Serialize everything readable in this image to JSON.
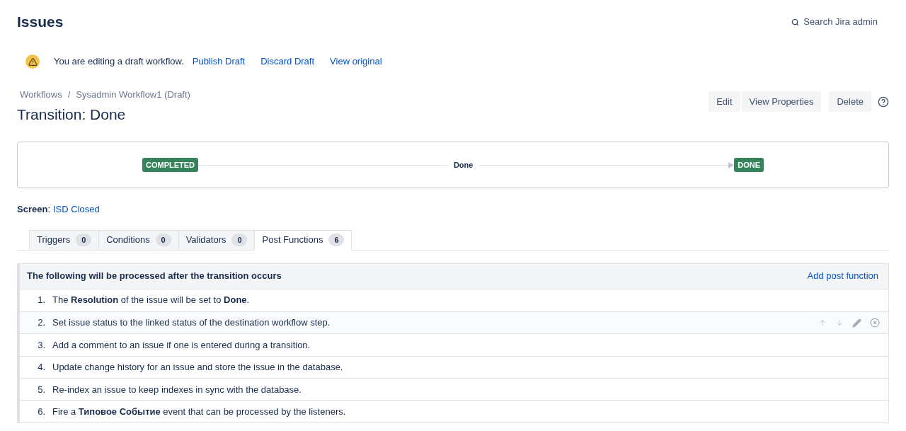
{
  "header": {
    "title": "Issues",
    "search": "Search Jira admin"
  },
  "draft_notice": {
    "message": "You are editing a draft workflow.",
    "links": [
      "Publish Draft",
      "Discard Draft",
      "View original"
    ]
  },
  "breadcrumbs": [
    "Workflows",
    "Sysadmin Workflow1 (Draft)"
  ],
  "breadcrumb_separator": "/",
  "page_title": "Transition: Done",
  "actions": [
    "Edit",
    "View Properties",
    "Delete"
  ],
  "diagram": {
    "from": "COMPLETED",
    "transition": "Done",
    "to": "DONE"
  },
  "screen": {
    "label": "Screen",
    "separator": ":",
    "value": "ISD Closed"
  },
  "tabs": [
    {
      "label": "Triggers",
      "count": "0",
      "selected": false
    },
    {
      "label": "Conditions",
      "count": "0",
      "selected": false
    },
    {
      "label": "Validators",
      "count": "0",
      "selected": false
    },
    {
      "label": "Post Functions",
      "count": "6",
      "selected": true
    }
  ],
  "panel": {
    "heading": "The following will be processed after the transition occurs",
    "add_link": "Add post function",
    "items": [
      {
        "number": "1.",
        "text": "The **Resolution** of the issue will be set to **Done**.",
        "hovered": false
      },
      {
        "number": "2.",
        "text": "Set issue status to the linked status of the destination workflow step.",
        "hovered": true
      },
      {
        "number": "3.",
        "text": "Add a comment to an issue if one is entered during a transition.",
        "hovered": false
      },
      {
        "number": "4.",
        "text": "Update change history for an issue and store the issue in the database.",
        "hovered": false
      },
      {
        "number": "5.",
        "text": "Re-index an issue to keep indexes in sync with the database.",
        "hovered": false
      },
      {
        "number": "6.",
        "text": "Fire a **Типовое Событие** event that can be processed by the listeners.",
        "hovered": false
      }
    ]
  }
}
